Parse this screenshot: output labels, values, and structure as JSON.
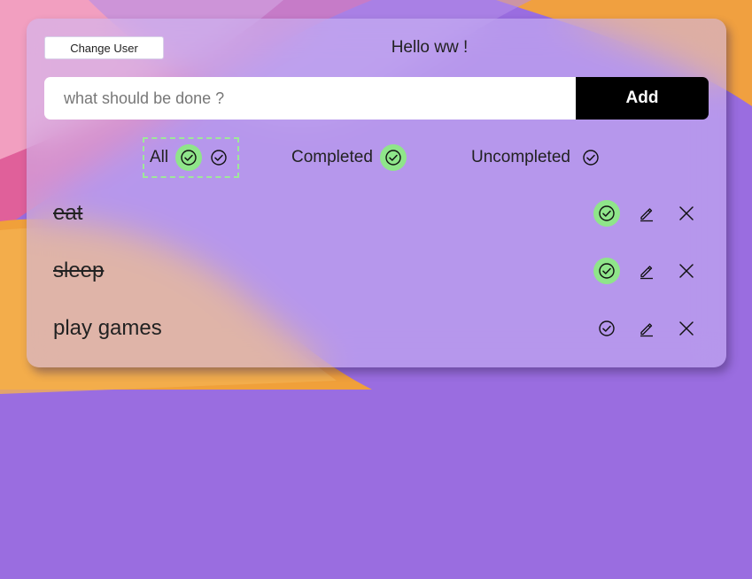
{
  "header": {
    "change_user_label": "Change User",
    "greeting": "Hello ww !"
  },
  "new_task": {
    "placeholder": "what should be done ?",
    "value": "",
    "add_label": "Add"
  },
  "filters": [
    {
      "label": "All",
      "active": true
    },
    {
      "label": "Completed",
      "active": false
    },
    {
      "label": "Uncompleted",
      "active": false
    }
  ],
  "todos": [
    {
      "text": "eat",
      "completed": true
    },
    {
      "text": "sleep",
      "completed": true
    },
    {
      "text": "play games",
      "completed": false
    }
  ],
  "icons": {
    "complete": "check-circle-icon",
    "edit": "pencil-icon",
    "delete": "close-icon"
  },
  "colors": {
    "accent_green": "#8fe58a",
    "add_button": "#000000",
    "card": "#cdb9f5"
  }
}
